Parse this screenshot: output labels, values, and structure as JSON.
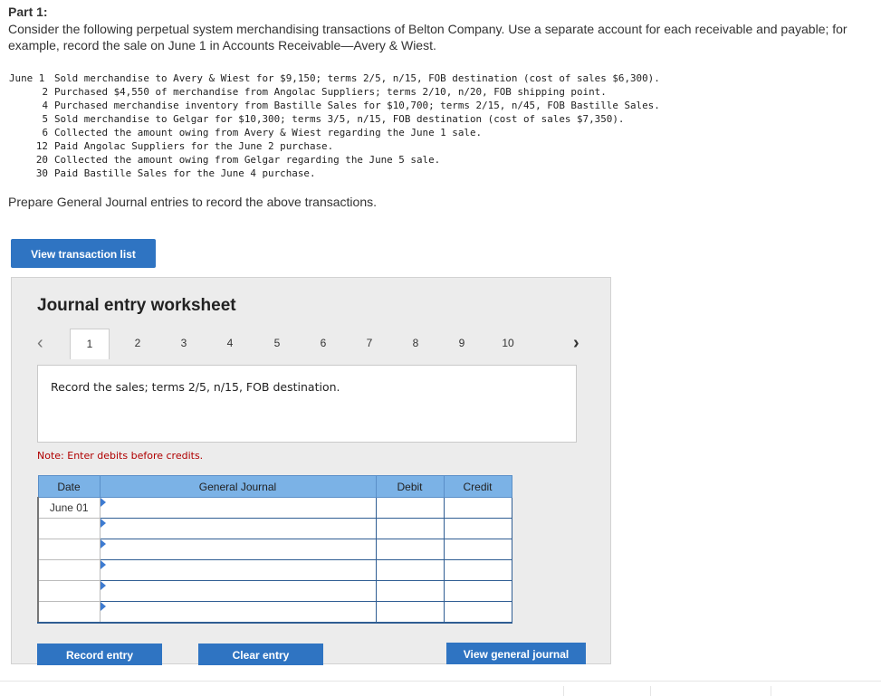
{
  "part_title": "Part 1:",
  "intro": "Consider the following perpetual system merchandising transactions of Belton Company. Use a separate account for each receivable and payable; for example, record the sale on June 1 in Accounts Receivable—Avery & Wiest.",
  "transactions": [
    {
      "date": "June 1",
      "text": "Sold merchandise to Avery & Wiest for $9,150; terms 2/5, n/15, FOB destination (cost of sales $6,300)."
    },
    {
      "date": "2",
      "text": "Purchased $4,550 of merchandise from Angolac Suppliers; terms 2/10, n/20, FOB shipping point."
    },
    {
      "date": "4",
      "text": "Purchased merchandise inventory from Bastille Sales for $10,700; terms 2/15, n/45, FOB Bastille Sales."
    },
    {
      "date": "5",
      "text": "Sold merchandise to Gelgar for $10,300; terms 3/5, n/15, FOB destination (cost of sales $7,350)."
    },
    {
      "date": "6",
      "text": "Collected the amount owing from Avery & Wiest regarding the June 1 sale."
    },
    {
      "date": "12",
      "text": "Paid Angolac Suppliers for the June 2 purchase."
    },
    {
      "date": "20",
      "text": "Collected the amount owing from Gelgar regarding the June 5 sale."
    },
    {
      "date": "30",
      "text": "Paid Bastille Sales for the June 4 purchase."
    }
  ],
  "instruction": "Prepare General Journal entries to record the above transactions.",
  "buttons": {
    "view_transaction_list": "View transaction list",
    "record_entry": "Record entry",
    "clear_entry": "Clear entry",
    "view_general_journal": "View general journal"
  },
  "worksheet": {
    "title": "Journal entry worksheet",
    "prev_icon": "‹",
    "next_icon": "›",
    "tabs": [
      "1",
      "2",
      "3",
      "4",
      "5",
      "6",
      "7",
      "8",
      "9",
      "10"
    ],
    "active_tab": "1",
    "description": "Record the sales; terms 2/5, n/15, FOB destination.",
    "note": "Note: Enter debits before credits.",
    "table": {
      "headers": {
        "date": "Date",
        "journal": "General Journal",
        "debit": "Debit",
        "credit": "Credit"
      },
      "rows": [
        {
          "date": "June 01"
        },
        {
          "date": ""
        },
        {
          "date": ""
        },
        {
          "date": ""
        },
        {
          "date": ""
        },
        {
          "date": ""
        }
      ]
    }
  },
  "colors": {
    "button_blue": "#2f74c2",
    "header_blue": "#7bb2e6",
    "note_red": "#b00000",
    "panel_gray": "#ececec"
  }
}
